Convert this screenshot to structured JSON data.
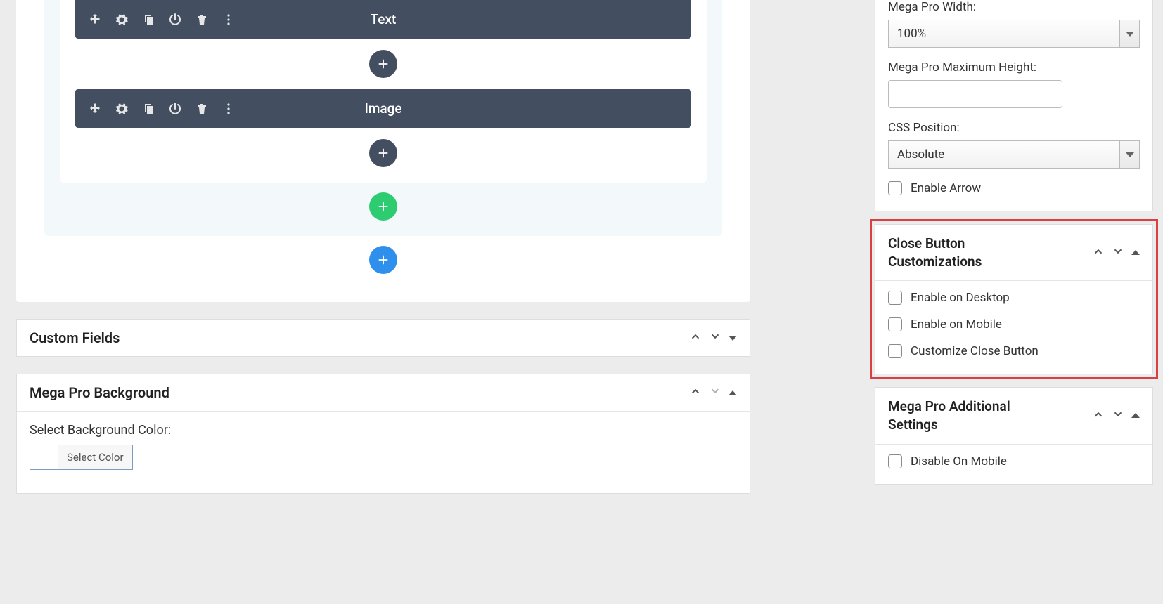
{
  "builder": {
    "blocks": [
      {
        "label": "Text"
      },
      {
        "label": "Image"
      }
    ]
  },
  "panels": {
    "custom_fields": {
      "title": "Custom Fields"
    },
    "mega_bg": {
      "title": "Mega Pro Background",
      "select_label": "Select Background Color:",
      "select_color_btn": "Select Color"
    }
  },
  "side": {
    "top": {
      "width_label": "Mega Pro Width:",
      "width_value": "100%",
      "max_height_label": "Mega Pro Maximum Height:",
      "max_height_value": "",
      "css_pos_label": "CSS Position:",
      "css_pos_value": "Absolute",
      "enable_arrow": "Enable Arrow"
    },
    "close_btn": {
      "title": "Close Button Customizations",
      "opts": [
        "Enable on Desktop",
        "Enable on Mobile",
        "Customize Close Button"
      ]
    },
    "additional": {
      "title": "Mega Pro Additional Settings",
      "opts": [
        "Disable On Mobile"
      ]
    }
  }
}
